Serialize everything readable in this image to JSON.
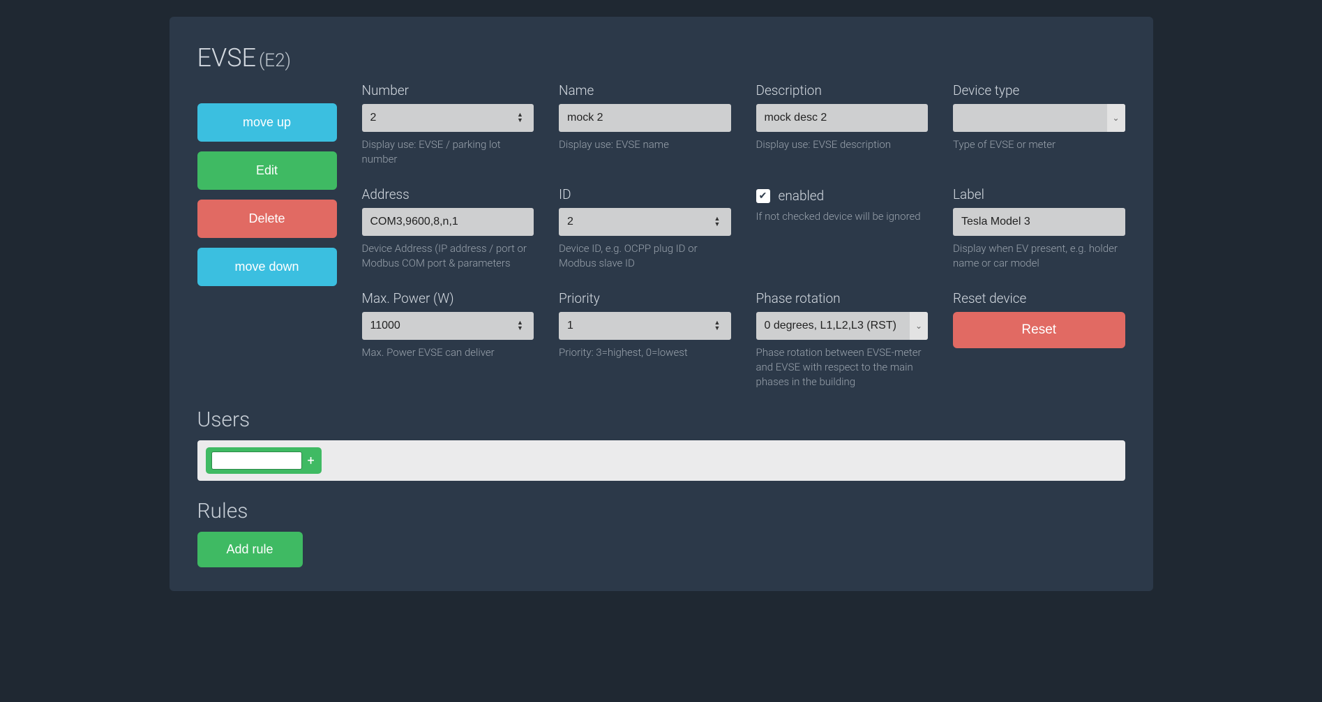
{
  "header": {
    "title": "EVSE",
    "subtitle": "(E2)"
  },
  "side": {
    "move_up": "move up",
    "edit": "Edit",
    "delete": "Delete",
    "move_down": "move down"
  },
  "fields": {
    "number": {
      "label": "Number",
      "value": "2",
      "help": "Display use: EVSE / parking lot number"
    },
    "name": {
      "label": "Name",
      "value": "mock 2",
      "help": "Display use: EVSE name"
    },
    "description": {
      "label": "Description",
      "value": "mock desc 2",
      "help": "Display use: EVSE description"
    },
    "device_type": {
      "label": "Device type",
      "value": "",
      "help": "Type of EVSE or meter"
    },
    "address": {
      "label": "Address",
      "value": "COM3,9600,8,n,1",
      "help": "Device Address (IP address / port or Modbus COM port & parameters"
    },
    "id": {
      "label": "ID",
      "value": "2",
      "help": "Device ID, e.g. OCPP plug ID or Modbus slave ID"
    },
    "enabled": {
      "label": "enabled",
      "checked": true,
      "help": "If not checked device will be ignored"
    },
    "label_f": {
      "label": "Label",
      "value": "Tesla Model 3",
      "help": "Display when EV present, e.g. holder name or car model"
    },
    "max_power": {
      "label": "Max. Power (W)",
      "value": "11000",
      "help": "Max. Power EVSE can deliver"
    },
    "priority": {
      "label": "Priority",
      "value": "1",
      "help": "Priority: 3=highest, 0=lowest"
    },
    "phase": {
      "label": "Phase rotation",
      "value": "0 degrees, L1,L2,L3 (RST)",
      "help": "Phase rotation between EVSE-meter and EVSE with respect to the main phases in the building"
    },
    "reset": {
      "label": "Reset device",
      "button": "Reset"
    }
  },
  "users": {
    "heading": "Users",
    "add_placeholder": ""
  },
  "rules": {
    "heading": "Rules",
    "add_button": "Add rule"
  }
}
